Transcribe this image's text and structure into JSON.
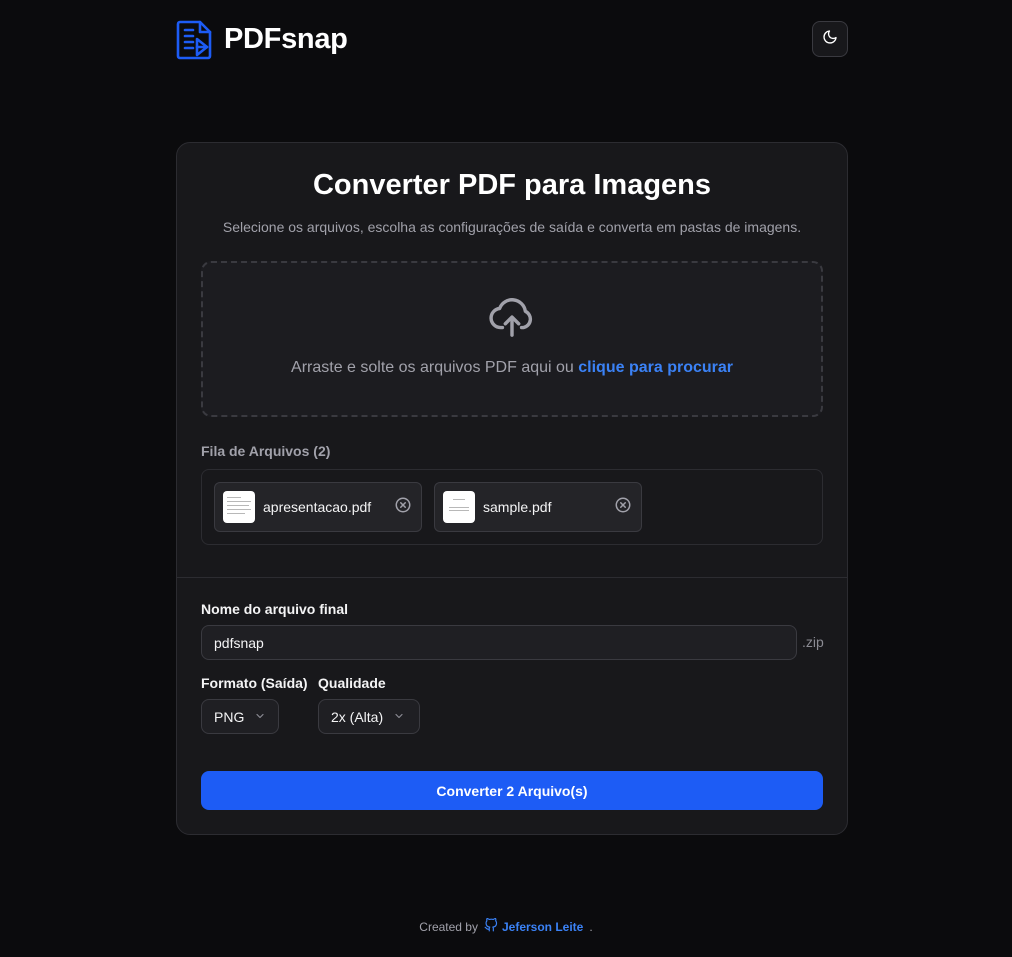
{
  "header": {
    "app_name": "PDFsnap",
    "logo_icon": "document-image-icon",
    "theme_toggle_icon": "moon-icon"
  },
  "main": {
    "title": "Converter PDF para Imagens",
    "subtitle": "Selecione os arquivos, escolha as configurações de saída e converta em pastas de imagens.",
    "dropzone": {
      "icon": "cloud-upload-icon",
      "text": "Arraste e solte os arquivos PDF aqui ou ",
      "link": "clique para procurar"
    },
    "queue": {
      "label": "Fila de Arquivos (2)",
      "files": [
        {
          "name": "apresentacao.pdf",
          "remove_icon": "close-circle-icon"
        },
        {
          "name": "sample.pdf",
          "remove_icon": "close-circle-icon"
        }
      ]
    },
    "output_name": {
      "label": "Nome do arquivo final",
      "value": "pdfsnap",
      "extension": ".zip"
    },
    "format": {
      "label": "Formato (Saída)",
      "selected": "PNG"
    },
    "quality": {
      "label": "Qualidade",
      "selected": "2x (Alta)"
    },
    "convert_button": "Converter 2 Arquivo(s)"
  },
  "footer": {
    "prefix": "Created by",
    "author": "Jeferson Leite",
    "suffix": ".",
    "author_icon": "github-icon"
  },
  "colors": {
    "background": "#0b0b0d",
    "card": "#18181b",
    "accent": "#1d5cf5",
    "link": "#3b82f6"
  }
}
